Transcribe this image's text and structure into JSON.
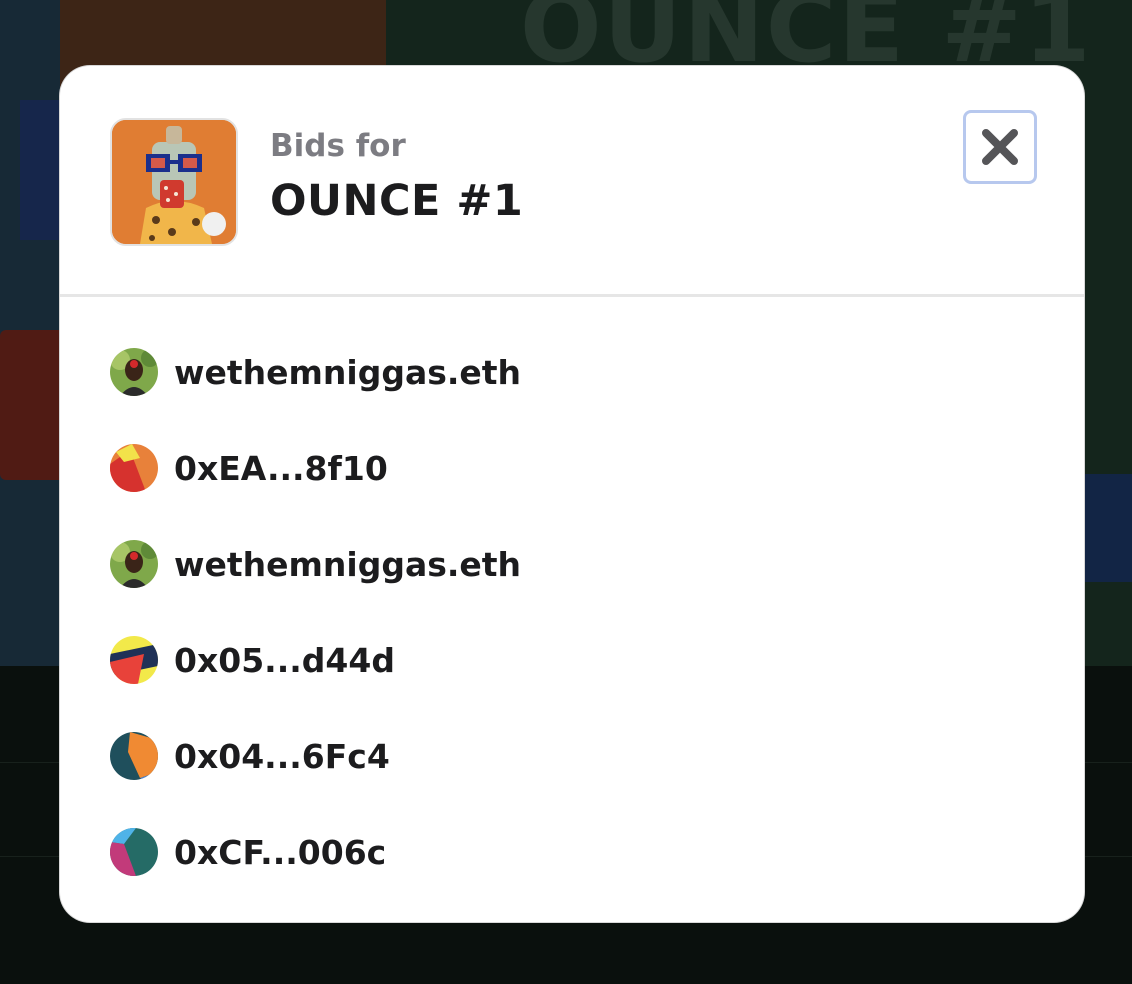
{
  "background": {
    "title": "OUNCE #1"
  },
  "modal": {
    "subtitle": "Bids for",
    "title": "OUNCE #1",
    "close_icon": "close-icon",
    "bids": [
      {
        "bidder": "wethemniggas.eth",
        "avatar": "photo-avatar"
      },
      {
        "bidder": "0xEA...8f10",
        "avatar": "generated-avatar",
        "colors": [
          "#e8813a",
          "#d6322e",
          "#f2e24a"
        ]
      },
      {
        "bidder": "wethemniggas.eth",
        "avatar": "photo-avatar"
      },
      {
        "bidder": "0x05...d44d",
        "avatar": "generated-avatar",
        "colors": [
          "#f2e94a",
          "#1f3157",
          "#e8423a"
        ]
      },
      {
        "bidder": "0x04...6Fc4",
        "avatar": "generated-avatar",
        "colors": [
          "#1f4f5c",
          "#f08a33",
          "#4d86d8"
        ]
      },
      {
        "bidder": "0xCF...006c",
        "avatar": "generated-avatar",
        "colors": [
          "#256b66",
          "#c23a7a",
          "#4fb3e8"
        ]
      }
    ]
  },
  "colors": {
    "accent_border": "#b7c8ee",
    "text_primary": "#1c1c1e",
    "text_secondary": "#7c7c82"
  }
}
